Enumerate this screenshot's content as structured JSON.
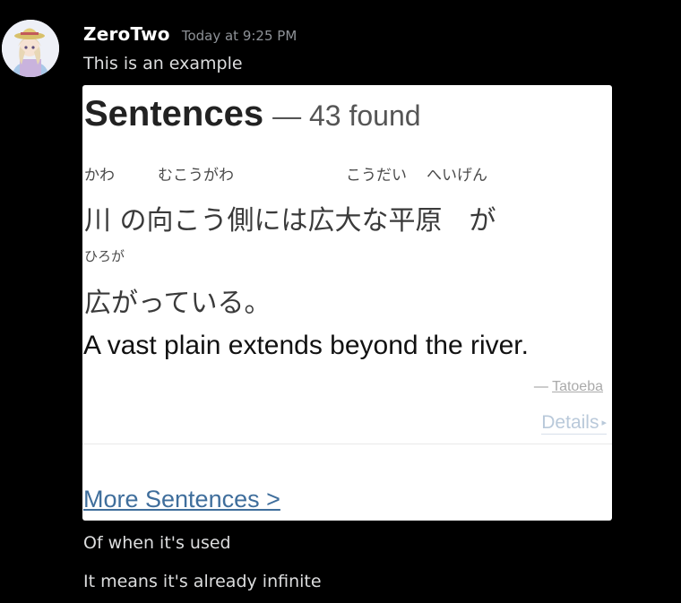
{
  "message": {
    "username": "ZeroTwo",
    "timestamp": "Today at 9:25 PM",
    "text_before": "This is an example",
    "text_after_1": "Of when it's used",
    "text_after_2": "It means it's already infinite",
    "avatar_icon": "user-avatar-icon"
  },
  "embed": {
    "title": "Sentences",
    "count": "— 43 found",
    "furigana_line1": [
      "かわ",
      "むこうがわ",
      "こうだい",
      "へいげん"
    ],
    "japanese_line1": "川 の向こう側には広大な平原　が",
    "furigana_line2": [
      "ひろが"
    ],
    "japanese_line2": "広がっている。",
    "english": "A vast plain extends beyond the river.",
    "source_prefix": "— ",
    "source_name": "Tatoeba",
    "details_label": "Details",
    "details_arrow": "▸",
    "more_label": "More Sentences >"
  },
  "colors": {
    "background": "#000000",
    "username": "#ffffff",
    "timestamp": "#8e9297",
    "message_text": "#dcddde",
    "link": "#3f6e9c"
  }
}
